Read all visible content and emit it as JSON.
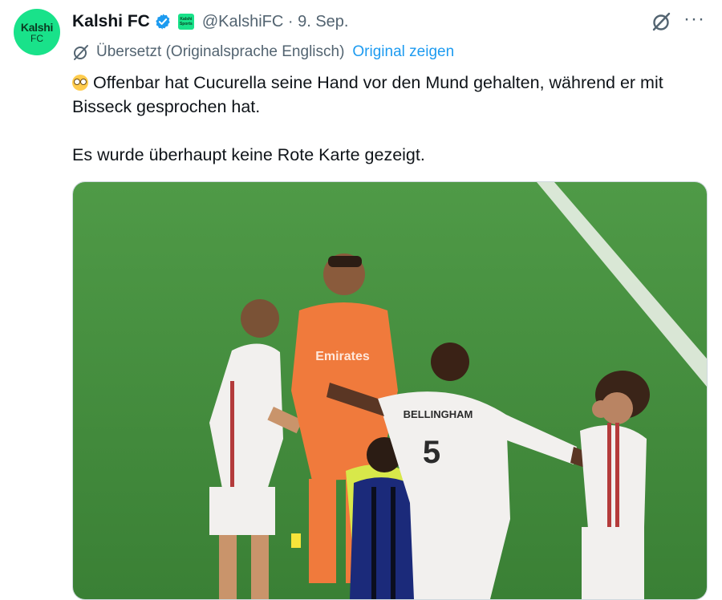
{
  "account": {
    "avatar_line1": "Kalshi",
    "avatar_line2": "FC",
    "name": "Kalshi FC",
    "affiliate_line1": "Kalshi",
    "affiliate_line2": "Sports",
    "handle": "@KalshiFC",
    "separator": "·",
    "date": "9. Sep."
  },
  "icons": {
    "verified": "verified-badge-icon",
    "grok": "grok-icon",
    "more": "more-icon",
    "translate": "translate-icon"
  },
  "translation": {
    "label": "Übersetzt (Originalsprache Englisch)",
    "show_original": "Original zeigen"
  },
  "tweet": {
    "line1": "Offenbar hat Cucurella seine Hand vor den Mund gehalten, während er mit Bisseck gesprochen hat.",
    "line2": "Es wurde überhaupt keine Rote Karte gezeigt."
  },
  "media": {
    "jersey_name": "BELLINGHAM",
    "jersey_number": "5",
    "sponsor": "Emirates",
    "colors": {
      "pitch": "#3f8a3a",
      "white_kit": "#f2f0ee",
      "keeper_kit": "#f07a3c",
      "inter_kit": "#1b2a7a",
      "referee_kit": "#d8e84a"
    }
  },
  "colors": {
    "accent": "#1d9bf0",
    "brand": "#19e28a",
    "secondary_text": "#536471"
  }
}
